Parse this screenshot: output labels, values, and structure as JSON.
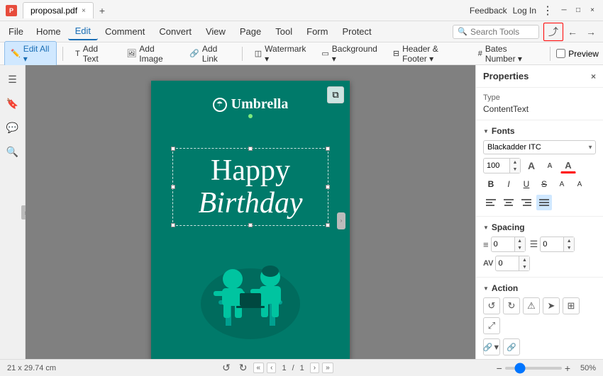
{
  "titleBar": {
    "tab": {
      "label": "proposal.pdf",
      "closeIcon": "×"
    },
    "newTabIcon": "+",
    "feedbackLabel": "Feedback",
    "loginLabel": "Log In",
    "moreIcon": "⋮",
    "minIcon": "─",
    "maxIcon": "□",
    "closeIcon": "×"
  },
  "menuBar": {
    "items": [
      {
        "id": "home",
        "label": "Home"
      },
      {
        "id": "edit",
        "label": "Edit",
        "active": true
      },
      {
        "id": "comment",
        "label": "Comment"
      },
      {
        "id": "convert",
        "label": "Convert"
      },
      {
        "id": "view",
        "label": "View"
      },
      {
        "id": "page",
        "label": "Page"
      },
      {
        "id": "tool",
        "label": "Tool"
      },
      {
        "id": "form",
        "label": "Form"
      },
      {
        "id": "protect",
        "label": "Protect"
      }
    ],
    "searchPlaceholder": "Search Tools",
    "shareIcon": "⤴",
    "backIcon": "←",
    "forwardIcon": "→"
  },
  "toolbar": {
    "editAll": "Edit All ▾",
    "addText": "Add Text",
    "addImage": "Add Image",
    "addLink": "Add Link",
    "watermark": "Watermark ▾",
    "background": "Background ▾",
    "headerFooter": "Header & Footer ▾",
    "batesNumber": "Bates Number ▾",
    "preview": "Preview"
  },
  "leftSidebar": {
    "icons": [
      "☰",
      "🔖",
      "💬",
      "🔍"
    ]
  },
  "pdf": {
    "logoText": "Umbrella",
    "happyText": "Happy",
    "birthdayText": "Birthday",
    "dimensions": "21 x 29.74 cm"
  },
  "propertiesPanel": {
    "title": "Properties",
    "closeIcon": "×",
    "typeLabel": "Type",
    "typeValue": "ContentText",
    "fontsLabel": "Fonts",
    "fontName": "Blackadder ITC",
    "fontSize": "100",
    "spacingLabel": "Spacing",
    "lineSpacingIcon": "≡",
    "paragraphSpacingIcon": "≡",
    "spacingValue1": "0",
    "spacingValue2": "0",
    "charSpacingIcon": "AV",
    "charSpacingValue": "0",
    "actionLabel": "Action",
    "boldLabel": "B",
    "italicLabel": "I",
    "underlineLabel": "U",
    "strikeLabel": "S",
    "superLabel": "A",
    "subLabel": "A",
    "alignLeft": "≡",
    "alignCenter": "≡",
    "alignRight": "≡",
    "alignJustify": "≡"
  },
  "statusBar": {
    "dimensions": "21 x 29.74 cm",
    "rotateLeft": "↺",
    "rotateRight": "↻",
    "page": "1",
    "pageTotal": "1",
    "prevPage": "‹",
    "nextPage": "›",
    "firstPage": "«",
    "lastPage": "»",
    "zoomOut": "−",
    "zoomIn": "+",
    "zoomLevel": "50%"
  }
}
